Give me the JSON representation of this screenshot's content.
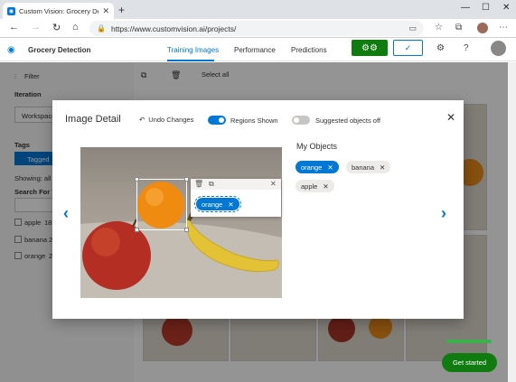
{
  "browser": {
    "tab_title": "Custom Vision: Grocery Detection",
    "tab_close": "✕",
    "new_tab": "+",
    "url": "https://www.customvision.ai/projects/",
    "window_controls": [
      "—",
      "☐",
      "✕"
    ]
  },
  "header": {
    "project_name": "Grocery Detection",
    "tabs": [
      "Training Images",
      "Performance",
      "Predictions"
    ],
    "active_tab": "Training Images",
    "brand_color": "#0078d4",
    "train_color": "#107c10"
  },
  "left_panel": {
    "filter_label": "Filter",
    "iteration_label": "Iteration",
    "iteration_value": "Workspace",
    "tags_label": "Tags",
    "tagged_button": "Tagged",
    "showing_text": "Showing: all t",
    "search_label": "Search For Ta",
    "tag_rows": [
      {
        "name": "apple",
        "count": "18"
      },
      {
        "name": "banana",
        "count": "2"
      },
      {
        "name": "orange",
        "count": "2"
      }
    ]
  },
  "grid": {
    "select_all": "Select all",
    "get_started": "Get started"
  },
  "modal": {
    "title": "Image Detail",
    "undo_label": "Undo Changes",
    "regions_label": "Regions Shown",
    "regions_on": true,
    "suggested_label": "Suggested objects off",
    "suggested_on": false,
    "region_tag": "orange",
    "my_objects_title": "My Objects",
    "objects": [
      {
        "label": "orange",
        "selected": true
      },
      {
        "label": "banana",
        "selected": false
      },
      {
        "label": "apple",
        "selected": false
      }
    ]
  }
}
